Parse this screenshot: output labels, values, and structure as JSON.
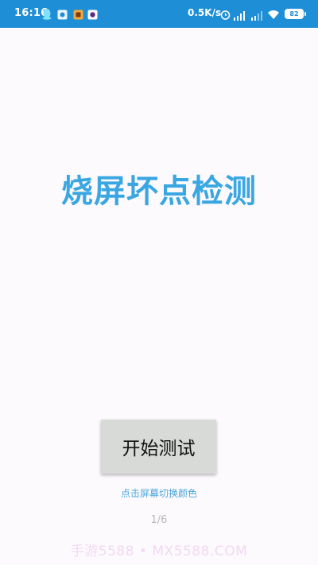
{
  "status_bar": {
    "time": "16:16",
    "net_speed": "0.5K/s",
    "battery": "82",
    "bar_color": "#1e8fd6",
    "icons": [
      "qq-icon",
      "app-notification-icon",
      "app-notification-icon",
      "app-notification-icon",
      "alarm-icon",
      "signal-icon",
      "signal-icon",
      "wifi-icon",
      "battery-icon"
    ]
  },
  "main": {
    "title": "烧屏坏点检测",
    "start_button_label": "开始测试",
    "hint": "点击屏幕切换颜色",
    "page_indicator": "1/6",
    "accent_color": "#3aa7e2"
  },
  "watermark": "手游5588 • MX5588.COM"
}
